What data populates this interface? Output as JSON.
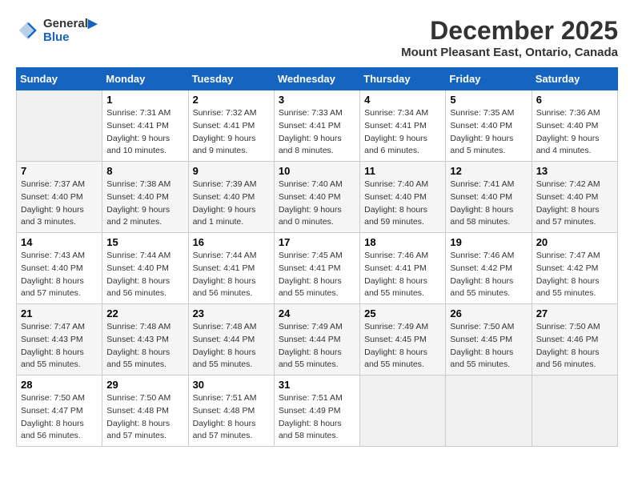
{
  "logo": {
    "line1": "General",
    "line2": "Blue"
  },
  "title": "December 2025",
  "subtitle": "Mount Pleasant East, Ontario, Canada",
  "days_of_week": [
    "Sunday",
    "Monday",
    "Tuesday",
    "Wednesday",
    "Thursday",
    "Friday",
    "Saturday"
  ],
  "weeks": [
    [
      {
        "day": "",
        "info": ""
      },
      {
        "day": "1",
        "info": "Sunrise: 7:31 AM\nSunset: 4:41 PM\nDaylight: 9 hours\nand 10 minutes."
      },
      {
        "day": "2",
        "info": "Sunrise: 7:32 AM\nSunset: 4:41 PM\nDaylight: 9 hours\nand 9 minutes."
      },
      {
        "day": "3",
        "info": "Sunrise: 7:33 AM\nSunset: 4:41 PM\nDaylight: 9 hours\nand 8 minutes."
      },
      {
        "day": "4",
        "info": "Sunrise: 7:34 AM\nSunset: 4:41 PM\nDaylight: 9 hours\nand 6 minutes."
      },
      {
        "day": "5",
        "info": "Sunrise: 7:35 AM\nSunset: 4:40 PM\nDaylight: 9 hours\nand 5 minutes."
      },
      {
        "day": "6",
        "info": "Sunrise: 7:36 AM\nSunset: 4:40 PM\nDaylight: 9 hours\nand 4 minutes."
      }
    ],
    [
      {
        "day": "7",
        "info": "Sunrise: 7:37 AM\nSunset: 4:40 PM\nDaylight: 9 hours\nand 3 minutes."
      },
      {
        "day": "8",
        "info": "Sunrise: 7:38 AM\nSunset: 4:40 PM\nDaylight: 9 hours\nand 2 minutes."
      },
      {
        "day": "9",
        "info": "Sunrise: 7:39 AM\nSunset: 4:40 PM\nDaylight: 9 hours\nand 1 minute."
      },
      {
        "day": "10",
        "info": "Sunrise: 7:40 AM\nSunset: 4:40 PM\nDaylight: 9 hours\nand 0 minutes."
      },
      {
        "day": "11",
        "info": "Sunrise: 7:40 AM\nSunset: 4:40 PM\nDaylight: 8 hours\nand 59 minutes."
      },
      {
        "day": "12",
        "info": "Sunrise: 7:41 AM\nSunset: 4:40 PM\nDaylight: 8 hours\nand 58 minutes."
      },
      {
        "day": "13",
        "info": "Sunrise: 7:42 AM\nSunset: 4:40 PM\nDaylight: 8 hours\nand 57 minutes."
      }
    ],
    [
      {
        "day": "14",
        "info": "Sunrise: 7:43 AM\nSunset: 4:40 PM\nDaylight: 8 hours\nand 57 minutes."
      },
      {
        "day": "15",
        "info": "Sunrise: 7:44 AM\nSunset: 4:40 PM\nDaylight: 8 hours\nand 56 minutes."
      },
      {
        "day": "16",
        "info": "Sunrise: 7:44 AM\nSunset: 4:41 PM\nDaylight: 8 hours\nand 56 minutes."
      },
      {
        "day": "17",
        "info": "Sunrise: 7:45 AM\nSunset: 4:41 PM\nDaylight: 8 hours\nand 55 minutes."
      },
      {
        "day": "18",
        "info": "Sunrise: 7:46 AM\nSunset: 4:41 PM\nDaylight: 8 hours\nand 55 minutes."
      },
      {
        "day": "19",
        "info": "Sunrise: 7:46 AM\nSunset: 4:42 PM\nDaylight: 8 hours\nand 55 minutes."
      },
      {
        "day": "20",
        "info": "Sunrise: 7:47 AM\nSunset: 4:42 PM\nDaylight: 8 hours\nand 55 minutes."
      }
    ],
    [
      {
        "day": "21",
        "info": "Sunrise: 7:47 AM\nSunset: 4:43 PM\nDaylight: 8 hours\nand 55 minutes."
      },
      {
        "day": "22",
        "info": "Sunrise: 7:48 AM\nSunset: 4:43 PM\nDaylight: 8 hours\nand 55 minutes."
      },
      {
        "day": "23",
        "info": "Sunrise: 7:48 AM\nSunset: 4:44 PM\nDaylight: 8 hours\nand 55 minutes."
      },
      {
        "day": "24",
        "info": "Sunrise: 7:49 AM\nSunset: 4:44 PM\nDaylight: 8 hours\nand 55 minutes."
      },
      {
        "day": "25",
        "info": "Sunrise: 7:49 AM\nSunset: 4:45 PM\nDaylight: 8 hours\nand 55 minutes."
      },
      {
        "day": "26",
        "info": "Sunrise: 7:50 AM\nSunset: 4:45 PM\nDaylight: 8 hours\nand 55 minutes."
      },
      {
        "day": "27",
        "info": "Sunrise: 7:50 AM\nSunset: 4:46 PM\nDaylight: 8 hours\nand 56 minutes."
      }
    ],
    [
      {
        "day": "28",
        "info": "Sunrise: 7:50 AM\nSunset: 4:47 PM\nDaylight: 8 hours\nand 56 minutes."
      },
      {
        "day": "29",
        "info": "Sunrise: 7:50 AM\nSunset: 4:48 PM\nDaylight: 8 hours\nand 57 minutes."
      },
      {
        "day": "30",
        "info": "Sunrise: 7:51 AM\nSunset: 4:48 PM\nDaylight: 8 hours\nand 57 minutes."
      },
      {
        "day": "31",
        "info": "Sunrise: 7:51 AM\nSunset: 4:49 PM\nDaylight: 8 hours\nand 58 minutes."
      },
      {
        "day": "",
        "info": ""
      },
      {
        "day": "",
        "info": ""
      },
      {
        "day": "",
        "info": ""
      }
    ]
  ]
}
